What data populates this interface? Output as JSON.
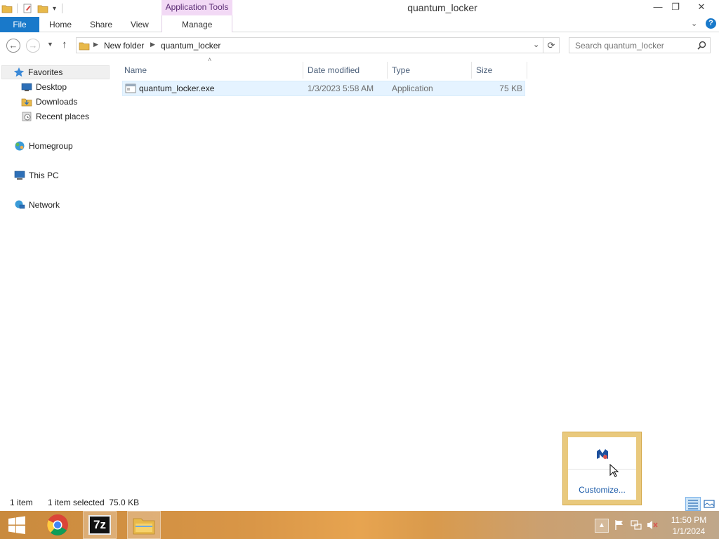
{
  "window": {
    "title": "quantum_locker",
    "contextual_tab_group": "Application Tools",
    "controls": {
      "minimize": "—",
      "restore": "❐",
      "close": "✕"
    }
  },
  "ribbon": {
    "tabs": [
      {
        "label": "File"
      },
      {
        "label": "Home"
      },
      {
        "label": "Share"
      },
      {
        "label": "View"
      },
      {
        "label": "Manage"
      }
    ],
    "accent": "#1979ca",
    "contextual_color": "#f2d9f5"
  },
  "address": {
    "breadcrumbs": [
      "New folder",
      "quantum_locker"
    ],
    "search_placeholder": "Search quantum_locker"
  },
  "navpane": {
    "favorites": {
      "label": "Favorites",
      "icon": "star-icon",
      "items": [
        {
          "label": "Desktop",
          "icon": "desktop-icon"
        },
        {
          "label": "Downloads",
          "icon": "downloads-icon"
        },
        {
          "label": "Recent places",
          "icon": "recent-places-icon"
        }
      ]
    },
    "homegroup": {
      "label": "Homegroup",
      "icon": "homegroup-icon"
    },
    "this_pc": {
      "label": "This PC",
      "icon": "computer-icon"
    },
    "network": {
      "label": "Network",
      "icon": "network-icon"
    }
  },
  "file_list": {
    "columns": [
      "Name",
      "Date modified",
      "Type",
      "Size"
    ],
    "rows": [
      {
        "name": "quantum_locker.exe",
        "date_modified": "1/3/2023 5:58 AM",
        "type": "Application",
        "size": "75 KB",
        "icon": "exe-file-icon",
        "selected": true
      }
    ]
  },
  "statusbar": {
    "item_count": "1 item",
    "selection": "1 item selected  75.0 KB"
  },
  "tray_popup": {
    "icon": "malwarebytes-icon",
    "customize_label": "Customize..."
  },
  "taskbar": {
    "apps": [
      {
        "icon": "windows-start-icon"
      },
      {
        "icon": "chrome-icon"
      },
      {
        "icon": "7zip-icon",
        "label": "7z"
      },
      {
        "icon": "file-explorer-icon"
      }
    ],
    "clock": {
      "time": "11:50 PM",
      "date": "1/1/2024"
    }
  }
}
